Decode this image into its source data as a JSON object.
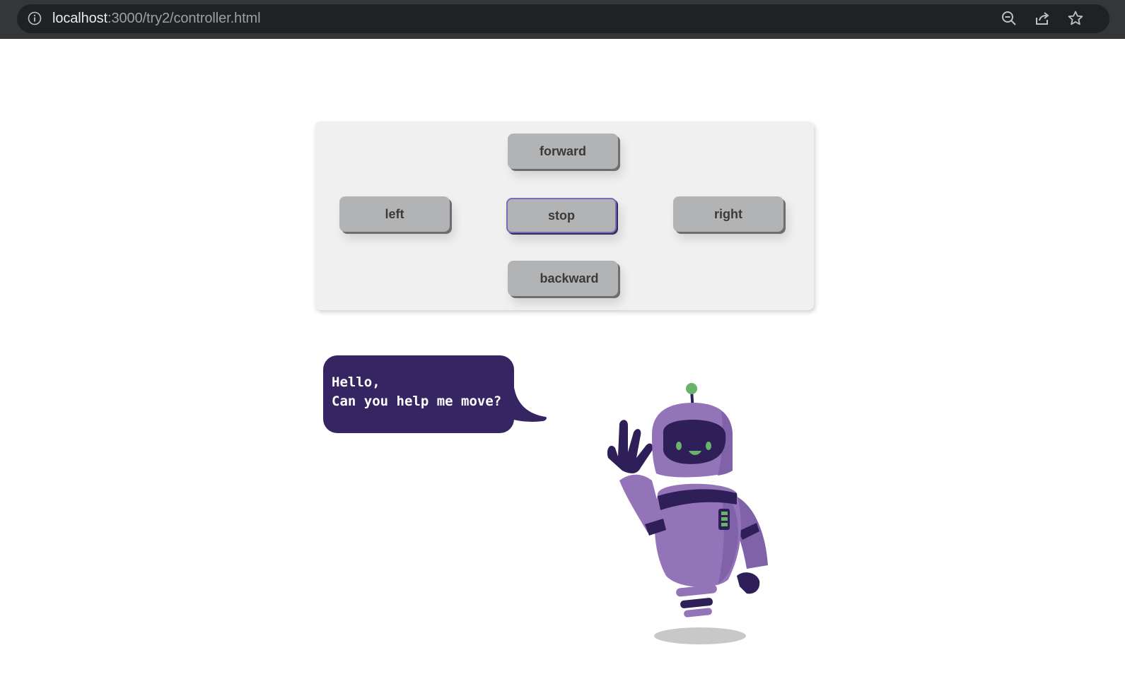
{
  "browser": {
    "url_host": "localhost",
    "url_rest": ":3000/try2/controller.html",
    "icons": [
      "info-icon",
      "zoom-out-icon",
      "share-icon",
      "bookmark-star-icon"
    ]
  },
  "controller": {
    "forward": "forward",
    "left": "left",
    "stop": "stop",
    "right": "right",
    "backward": "backward"
  },
  "speech": {
    "line1": "Hello,",
    "line2": "Can you help me move?"
  },
  "colors": {
    "bubble": "#362563",
    "robot_body": "#9474b8",
    "robot_dark": "#2f1f59",
    "robot_accent": "#6ab36a"
  }
}
